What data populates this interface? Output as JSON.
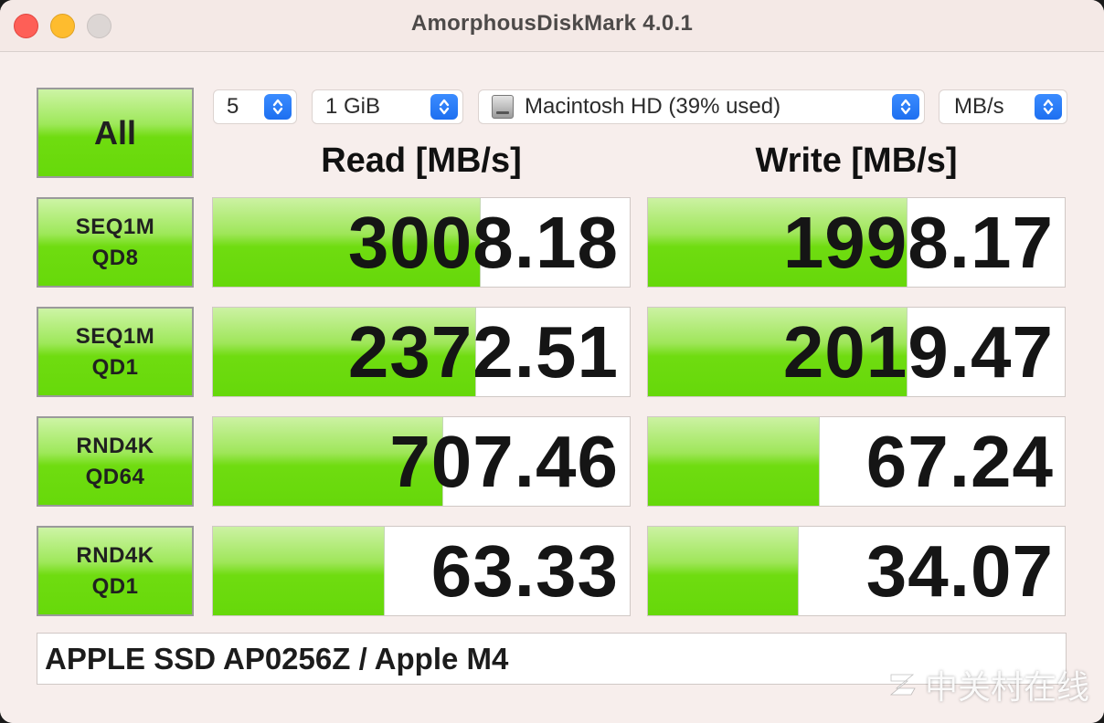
{
  "window": {
    "title": "AmorphousDiskMark 4.0.1"
  },
  "controls": {
    "count": "5",
    "size": "1 GiB",
    "drive": "Macintosh HD (39% used)",
    "unit": "MB/s"
  },
  "buttons": {
    "all": "All",
    "tests": [
      {
        "line1": "SEQ1M",
        "line2": "QD8"
      },
      {
        "line1": "SEQ1M",
        "line2": "QD1"
      },
      {
        "line1": "RND4K",
        "line2": "QD64"
      },
      {
        "line1": "RND4K",
        "line2": "QD1"
      }
    ]
  },
  "headers": {
    "read": "Read [MB/s]",
    "write": "Write [MB/s]"
  },
  "results": {
    "read": [
      {
        "value": "3008.18",
        "fill": 0.64
      },
      {
        "value": "2372.51",
        "fill": 0.63
      },
      {
        "value": "707.46",
        "fill": 0.55
      },
      {
        "value": "63.33",
        "fill": 0.41
      }
    ],
    "write": [
      {
        "value": "1998.17",
        "fill": 0.62
      },
      {
        "value": "2019.47",
        "fill": 0.62
      },
      {
        "value": "67.24",
        "fill": 0.41
      },
      {
        "value": "34.07",
        "fill": 0.36
      }
    ]
  },
  "footer": {
    "device": "APPLE SSD AP0256Z / Apple M4"
  },
  "watermark": {
    "text": "中关村在线"
  },
  "colors": {
    "bar_green": "#6fdc10",
    "accent_blue": "#1d6ff0",
    "close": "#fe5f57",
    "minimize": "#febc2e"
  }
}
